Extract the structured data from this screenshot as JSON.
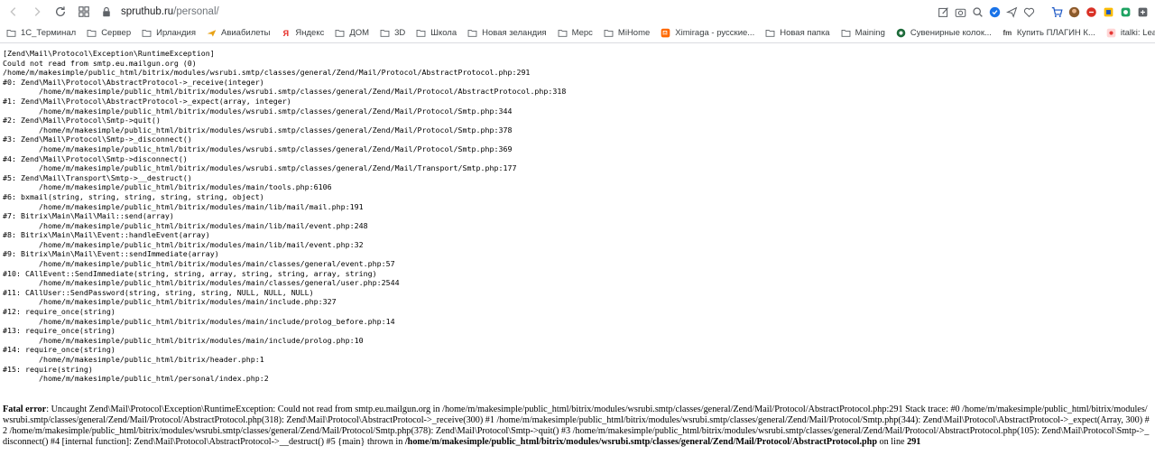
{
  "browser": {
    "url_host": "spruthub.ru",
    "url_path": "/personal/"
  },
  "bookmarks": [
    {
      "label": "1С_Терминал",
      "icon": "folder-icon"
    },
    {
      "label": "Сервер",
      "icon": "folder-icon"
    },
    {
      "label": "Ирландия",
      "icon": "folder-icon"
    },
    {
      "label": "Авиабилеты",
      "icon": "plane-icon"
    },
    {
      "label": "Яндекс",
      "icon": "yandex-icon"
    },
    {
      "label": "ДОМ",
      "icon": "folder-icon"
    },
    {
      "label": "3D",
      "icon": "folder-icon"
    },
    {
      "label": "Школа",
      "icon": "folder-icon"
    },
    {
      "label": "Новая зеландия",
      "icon": "folder-icon"
    },
    {
      "label": "Мерс",
      "icon": "folder-icon"
    },
    {
      "label": "MiHome",
      "icon": "folder-icon"
    },
    {
      "label": "Ximiraga - русские...",
      "icon": "mi-icon"
    },
    {
      "label": "Новая папка",
      "icon": "folder-icon"
    },
    {
      "label": "Maining",
      "icon": "folder-icon"
    },
    {
      "label": "Сувенирные колок...",
      "icon": "globe-icon"
    },
    {
      "label": "Купить ПЛАГИН К...",
      "icon": "fm-icon"
    },
    {
      "label": "italki: Learn a langu...",
      "icon": "italki-icon"
    }
  ],
  "trace_text": "[Zend\\Mail\\Protocol\\Exception\\RuntimeException]\nCould not read from smtp.eu.mailgun.org (0)\n/home/m/makesimple/public_html/bitrix/modules/wsrubi.smtp/classes/general/Zend/Mail/Protocol/AbstractProtocol.php:291\n#0: Zend\\Mail\\Protocol\\AbstractProtocol->_receive(integer)\n\t/home/m/makesimple/public_html/bitrix/modules/wsrubi.smtp/classes/general/Zend/Mail/Protocol/AbstractProtocol.php:318\n#1: Zend\\Mail\\Protocol\\AbstractProtocol->_expect(array, integer)\n\t/home/m/makesimple/public_html/bitrix/modules/wsrubi.smtp/classes/general/Zend/Mail/Protocol/Smtp.php:344\n#2: Zend\\Mail\\Protocol\\Smtp->quit()\n\t/home/m/makesimple/public_html/bitrix/modules/wsrubi.smtp/classes/general/Zend/Mail/Protocol/Smtp.php:378\n#3: Zend\\Mail\\Protocol\\Smtp->_disconnect()\n\t/home/m/makesimple/public_html/bitrix/modules/wsrubi.smtp/classes/general/Zend/Mail/Protocol/Smtp.php:369\n#4: Zend\\Mail\\Protocol\\Smtp->disconnect()\n\t/home/m/makesimple/public_html/bitrix/modules/wsrubi.smtp/classes/general/Zend/Mail/Transport/Smtp.php:177\n#5: Zend\\Mail\\Transport\\Smtp->__destruct()\n\t/home/m/makesimple/public_html/bitrix/modules/main/tools.php:6106\n#6: bxmail(string, string, string, string, string, object)\n\t/home/m/makesimple/public_html/bitrix/modules/main/lib/mail/mail.php:191\n#7: Bitrix\\Main\\Mail\\Mail::send(array)\n\t/home/m/makesimple/public_html/bitrix/modules/main/lib/mail/event.php:248\n#8: Bitrix\\Main\\Mail\\Event::handleEvent(array)\n\t/home/m/makesimple/public_html/bitrix/modules/main/lib/mail/event.php:32\n#9: Bitrix\\Main\\Mail\\Event::sendImmediate(array)\n\t/home/m/makesimple/public_html/bitrix/modules/main/classes/general/event.php:57\n#10: CAllEvent::SendImmediate(string, string, array, string, string, array, string)\n\t/home/m/makesimple/public_html/bitrix/modules/main/classes/general/user.php:2544\n#11: CAllUser::SendPassword(string, string, string, NULL, NULL, NULL)\n\t/home/m/makesimple/public_html/bitrix/modules/main/include.php:327\n#12: require_once(string)\n\t/home/m/makesimple/public_html/bitrix/modules/main/include/prolog_before.php:14\n#13: require_once(string)\n\t/home/m/makesimple/public_html/bitrix/modules/main/include/prolog.php:10\n#14: require_once(string)\n\t/home/m/makesimple/public_html/bitrix/header.php:1\n#15: require(string)\n\t/home/m/makesimple/public_html/personal/index.php:2",
  "fatal": {
    "label": "Fatal error",
    "message": ": Uncaught Zend\\Mail\\Protocol\\Exception\\RuntimeException: Could not read from smtp.eu.mailgun.org in /home/m/makesimple/public_html/bitrix/modules/wsrubi.smtp/classes/general/Zend/Mail/Protocol/AbstractProtocol.php:291 Stack trace: #0 /home/m/makesimple/public_html/bitrix/modules/wsrubi.smtp/classes/general/Zend/Mail/Protocol/AbstractProtocol.php(318): Zend\\Mail\\Protocol\\AbstractProtocol->_receive(300) #1 /home/m/makesimple/public_html/bitrix/modules/wsrubi.smtp/classes/general/Zend/Mail/Protocol/Smtp.php(344): Zend\\Mail\\Protocol\\AbstractProtocol->_expect(Array, 300) #2 /home/m/makesimple/public_html/bitrix/modules/wsrubi.smtp/classes/general/Zend/Mail/Protocol/Smtp.php(378): Zend\\Mail\\Protocol\\Smtp->quit() #3 /home/m/makesimple/public_html/bitrix/modules/wsrubi.smtp/classes/general/Zend/Mail/Protocol/AbstractProtocol.php(105): Zend\\Mail\\Protocol\\Smtp->_disconnect() #4 [internal function]: Zend\\Mail\\Protocol\\AbstractProtocol->__destruct() #5 {main} thrown in ",
    "file": "/home/m/makesimple/public_html/bitrix/modules/wsrubi.smtp/classes/general/Zend/Mail/Protocol/AbstractProtocol.php",
    "online": " on line ",
    "line": "291"
  }
}
